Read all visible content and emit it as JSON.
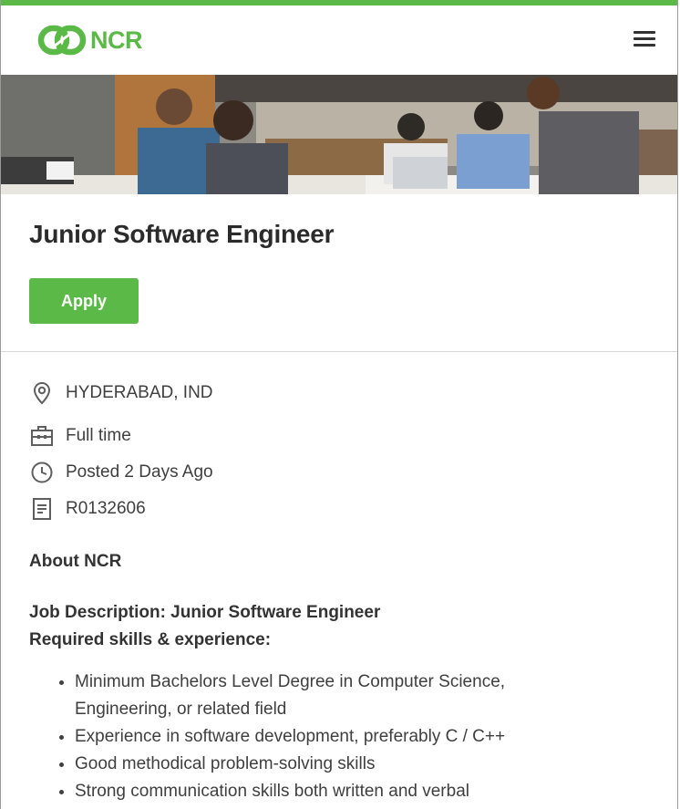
{
  "header": {
    "logo_text": "NCR",
    "menu_icon": "hamburger-menu-icon",
    "accent_color": "#5bb947"
  },
  "job": {
    "title": "Junior Software Engineer",
    "apply_label": "Apply",
    "location": "HYDERABAD, IND",
    "type": "Full time",
    "posted": "Posted 2 Days Ago",
    "req_id": "R0132606"
  },
  "content": {
    "about_heading": "About NCR",
    "description_heading": "Job Description: Junior Software Engineer",
    "skills_heading": "Required skills & experience:",
    "skills": [
      "Minimum Bachelors Level Degree in Computer Science, Engineering, or related field",
      "Experience in software development, preferably C / C++",
      "Good methodical problem-solving skills",
      "Strong communication skills both written and verbal"
    ]
  }
}
